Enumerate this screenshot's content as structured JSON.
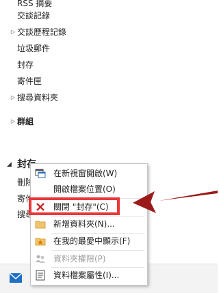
{
  "folders_top": [
    {
      "label": "RSS 摘要",
      "expandable": false
    },
    {
      "label": "交談記錄",
      "expandable": false
    },
    {
      "label": "交談歷程記錄",
      "expandable": true
    },
    {
      "label": "垃圾郵件",
      "expandable": false
    },
    {
      "label": "封存",
      "expandable": false
    },
    {
      "label": "寄件匣",
      "expandable": false
    },
    {
      "label": "搜尋資料夾",
      "expandable": true
    }
  ],
  "groups_label": "群組",
  "archive_section": {
    "label": "封存",
    "items": [
      "刪除",
      "寄件",
      "搜尋"
    ]
  },
  "context_menu": {
    "items": [
      {
        "label": "在新視窗開啟(W)",
        "icon": "new-window-icon",
        "disabled": false
      },
      {
        "label": "開啟檔案位置(O)",
        "icon": "",
        "disabled": false
      },
      {
        "label": "關閉 \"封存\"(C)",
        "icon": "close-x-icon",
        "disabled": false
      },
      {
        "label": "新增資料夾(N)...",
        "icon": "folder-icon",
        "disabled": false
      },
      {
        "label": "在我的最愛中顯示(F)",
        "icon": "favorite-folder-icon",
        "disabled": false
      },
      {
        "label": "資料夾權限(P)",
        "icon": "permissions-icon",
        "disabled": true
      },
      {
        "label": "資料檔案屬性(I)...",
        "icon": "properties-icon",
        "disabled": false
      }
    ]
  },
  "colors": {
    "highlight": "#e8383a",
    "arrow": "#9b1b1b",
    "mail_icon": "#1e6fc5"
  }
}
